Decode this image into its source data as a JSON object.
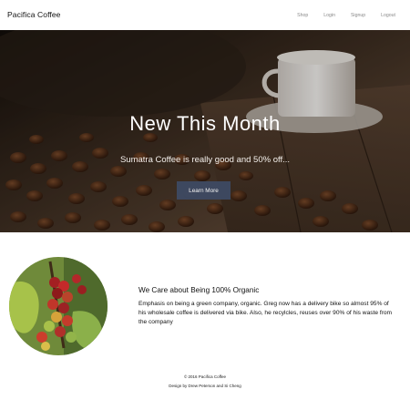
{
  "header": {
    "brand": "Pacifica Coffee",
    "nav": [
      "Shop",
      "Login",
      "Signup",
      "Logout"
    ]
  },
  "hero": {
    "title": "New This Month",
    "subtitle": "Sumatra Coffee is really good and 50% off...",
    "button": "Learn More"
  },
  "feature": {
    "title": "We Care about Being 100% Organic",
    "body": "Emphasis on being a green company, organic. Greg now has a delivery bike so almost 95% of his wholesale coffee is delivered via bike. Also, he recylcles, reuses over 90% of his waste from the company"
  },
  "footer": {
    "copyright": "© 2016 Pacifica Coffee",
    "credits": "Design by Drew Peterson and Si Cheng"
  },
  "colors": {
    "button": "#3e4a63",
    "hero_overlay": "#1a130e"
  }
}
